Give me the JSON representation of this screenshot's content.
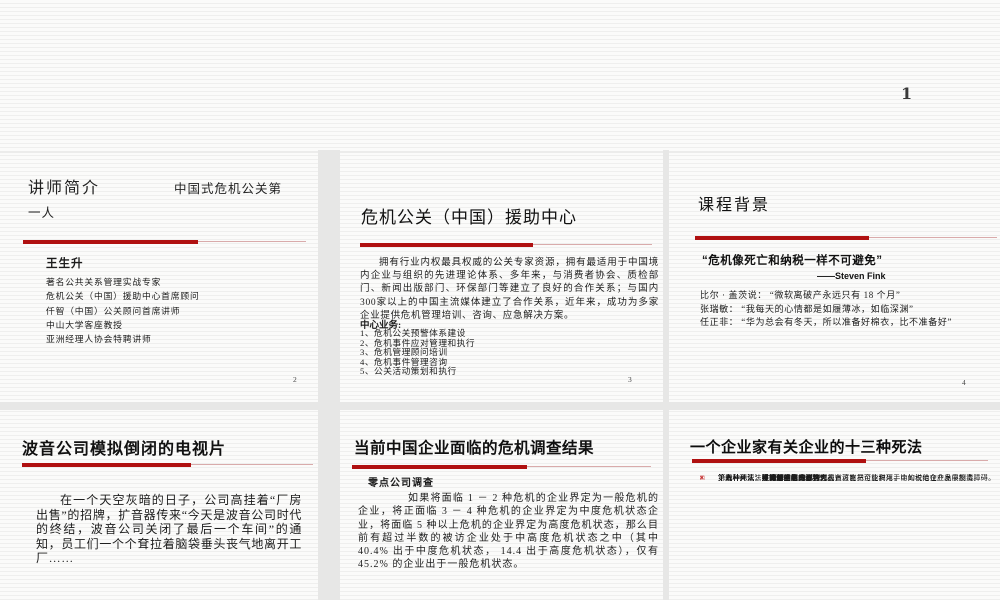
{
  "page": {
    "number": "1"
  },
  "colors": {
    "accent_red": "#b01111",
    "thin_rule": "#d9abab",
    "bullet_red": "#c01414",
    "text": "#1c1c1c"
  },
  "slides": [
    {
      "page_number": "2",
      "title": "讲师简介",
      "title_suffix": "中国式危机公关第一人",
      "speaker": "王生升",
      "credentials": [
        "著名公共关系管理实战专家",
        "危机公关（中国）援助中心首席顾问",
        "仟智（中国）公关顾问首席讲师",
        "中山大学客座教授",
        "亚洲经理人协会特聘讲师"
      ]
    },
    {
      "page_number": "3",
      "title": "危机公关（中国）援助中心",
      "paragraph": "拥有行业内权最具权威的公关专家资源，拥有最适用于中国境内企业与组织的先进理论体系、多年来，与消费者协会、质检部门、新闻出版部门、环保部门等建立了良好的合作关系；与国内300家以上的中国主流媒体建立了合作关系，近年来，成功为多家企业提供危机管理培训、咨询、应急解决方案。",
      "services_heading": "中心业务:",
      "services": [
        "1、危机公关预警体系建设",
        "2、危机事件应对管理和执行",
        "3、危机管理顾问培训",
        "4、危机事件管理咨询",
        "5、公关活动策划和执行"
      ]
    },
    {
      "page_number": "4",
      "title": "课程背景",
      "quote": "“危机像死亡和纳税一样不可避免”",
      "quote_author": "——Steven Fink",
      "quotes": [
        "比尔 · 盖茨说： “微软离破产永远只有 18 个月”",
        "张瑞敏： “我每天的心情都是如履薄冰，如临深渊”",
        "任正非： “华为总会有冬天，所以准备好棉衣，比不准备好”"
      ]
    },
    {
      "title": "波音公司模拟倒闭的电视片",
      "paragraph": "在一个天空灰暗的日子，公司高挂着“厂房出售”的招牌，扩音器传来“今天是波音公司时代的终结，波音公司关闭了最后一个车间”的通知，员工们一个个耷拉着脑袋垂头丧气地离开工厂……"
    },
    {
      "title": "当前中国企业面临的危机调查结果",
      "subtitle": "零点公司调查",
      "paragraph": "如果将面临 1 － 2 种危机的企业界定为一般危机的企业，将正面临 3 － 4 种危机的企业界定为中度危机状态企业，将面临 5 种以上危机的企业界定为高度危机状态，那么目前有超过半数的被访企业处于中高度危机状态之中（其中 40.4% 出于中度危机状态， 14.4 出于高度危机状态），仅有 45.2% 的企业出于一般危机状态。"
    },
    {
      "title": "一个企业家有关企业的十三种死法",
      "items": [
        {
          "bullet": "□",
          "text": "第一种死法：不正当竞争。"
        },
        {
          "bullet": "×",
          "text": "第二种死法：碰到恶意的“消费者”。"
        },
        {
          "bullet": "×",
          "text": "第三种死法：媒体的围剿。"
        },
        {
          "bullet": "×",
          "text": "第四种死法：媒体对产品的不客观报道。"
        },
        {
          "bullet": "×",
          "text": "第五种死法：主管部门把企业搞死。"
        },
        {
          "bullet": "×",
          "text": "第六种死法：法律制度上的弹性。"
        },
        {
          "bullet": "×",
          "text": "第七种死法：被骗。"
        },
        {
          "bullet": "×",
          "text": "第八种死法：“红眼病”的威胁。"
        },
        {
          "bullet": "×",
          "text": "第九种死法：黑社会的敲诈。"
        },
        {
          "bullet": "×",
          "text": "第十种死法：得罪某手中有权力官员，该官员可能利用手中的权给企业发展制造障碍。"
        },
        {
          "bullet": "×",
          "text": "第十一种死法：得罪了某一恶势力也有可能把企业搞死，比如说他在产品中投毒。"
        }
      ]
    }
  ]
}
